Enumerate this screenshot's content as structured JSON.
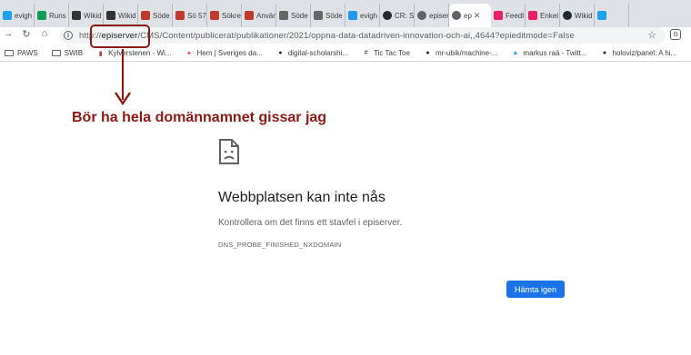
{
  "tabs": [
    {
      "label": "evigh",
      "icon": "twitter-icon",
      "color": "#1da1f2"
    },
    {
      "label": "Runs",
      "icon": "sheets-icon",
      "color": "#0f9d58"
    },
    {
      "label": "Wikid",
      "icon": "wikidata-icon",
      "color": "#333333"
    },
    {
      "label": "Wikid",
      "icon": "wikidata-icon",
      "color": "#333333"
    },
    {
      "label": "Söde",
      "icon": "kb-icon",
      "color": "#c0392b"
    },
    {
      "label": "Sö 57",
      "icon": "asterisk-icon",
      "color": "#c0392b"
    },
    {
      "label": "Sökre",
      "icon": "kb-icon",
      "color": "#c0392b"
    },
    {
      "label": "Använ",
      "icon": "kb-icon",
      "color": "#c0392b"
    },
    {
      "label": "Söde",
      "icon": "b-icon",
      "color": "#666666"
    },
    {
      "label": "Söde",
      "icon": "b-icon",
      "color": "#666666"
    },
    {
      "label": "evigh",
      "icon": "diamond-icon",
      "color": "#2196f3"
    },
    {
      "label": "CR: S",
      "icon": "github-icon",
      "color": "#24292e"
    },
    {
      "label": "episer",
      "icon": "globe-icon",
      "color": "#5f6368"
    },
    {
      "label": "ep",
      "icon": "globe-icon",
      "color": "#5f6368",
      "active": true
    },
    {
      "label": "Feedl",
      "icon": "pinwheel-icon",
      "color": "#e91e63"
    },
    {
      "label": "Enkel",
      "icon": "pinwheel-icon",
      "color": "#e91e63"
    },
    {
      "label": "Wikid",
      "icon": "github-icon",
      "color": "#24292e"
    },
    {
      "label": "",
      "icon": "twitter-icon",
      "color": "#1da1f2"
    }
  ],
  "active_tab_close": "✕",
  "url": {
    "scheme": "http://",
    "host": "episerver",
    "path": "/CMS/Content/publicerat/publikationer/2021/oppna-data-datadriven-innovation-och-ai,,4644?epieditmode=False"
  },
  "bookmarks": [
    {
      "label": "PAWS",
      "icon": "folder-icon"
    },
    {
      "label": "SWIB",
      "icon": "folder-icon"
    },
    {
      "label": "Kylverstenen - Wi...",
      "icon": "kb-icon"
    },
    {
      "label": "Hem | Sveriges da...",
      "icon": "pinwheel-icon"
    },
    {
      "label": "digital-scholarshi...",
      "icon": "github-icon"
    },
    {
      "label": "Tic Tac Toe",
      "icon": "tictactoe-icon"
    },
    {
      "label": "mr-ubik/machine-...",
      "icon": "github-icon"
    },
    {
      "label": "markus raä - Twitt...",
      "icon": "twitter-icon"
    },
    {
      "label": "holoviz/panel: A hi...",
      "icon": "github-icon"
    }
  ],
  "annotation": {
    "text": "Bör ha hela domännamnet gissar jag",
    "color": "#8b1a14"
  },
  "error": {
    "title": "Webbplatsen kan inte nås",
    "description": "Kontrollera om det finns ett stavfel i episerver.",
    "code": "DNS_PROBE_FINISHED_NXDOMAIN",
    "reload_label": "Hämta igen"
  },
  "colors": {
    "accent": "#1a73e8",
    "annotation": "#8b1a14"
  }
}
